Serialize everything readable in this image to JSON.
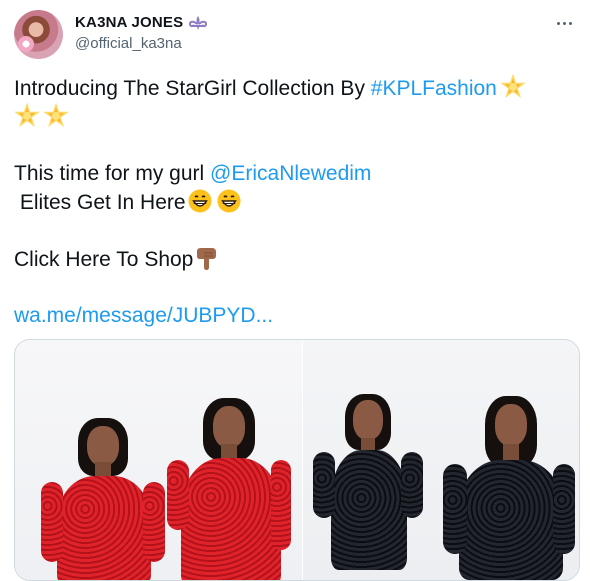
{
  "user": {
    "display_name": "KA3NA JONES",
    "handle": "@official_ka3na",
    "badge_icon": "fleur-de-lis-icon"
  },
  "tweet": {
    "line1_text": "Introducing The StarGirl Collection By ",
    "line1_hashtag": "#KPLFashion",
    "line3_text": "This time for my gurl ",
    "line3_mention": "@EricaNlewedim",
    "line4_text": " Elites Get In Here",
    "line5_text": "Click Here To Shop",
    "link_text": "wa.me/message/JUBPYD..."
  },
  "icons": {
    "star": "glowing-star-emoji",
    "grin": "grinning-face-emoji",
    "point_down": "backhand-index-pointing-down-emoji",
    "more": "more-options-icon"
  },
  "colors": {
    "link": "#1d9bf0",
    "text": "#0f1419",
    "muted": "#536471"
  }
}
